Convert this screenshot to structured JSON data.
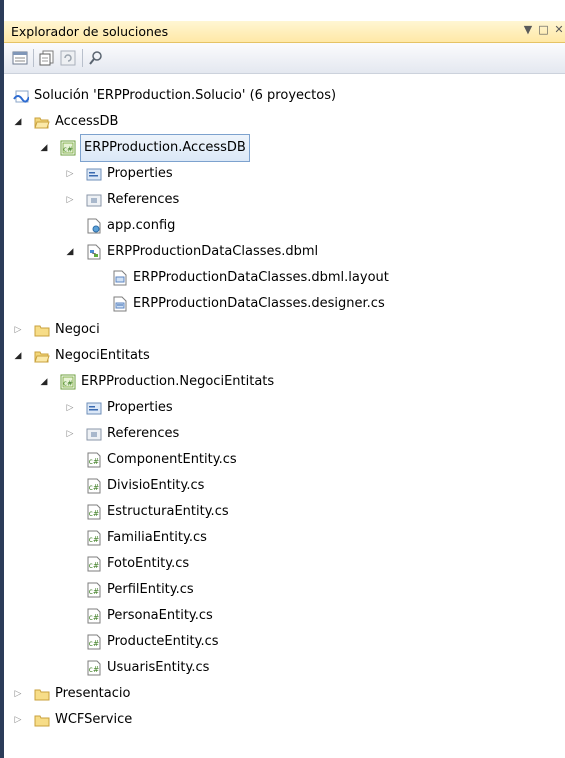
{
  "panel": {
    "title": "Explorador de soluciones",
    "controls": {
      "dropdown": "▼",
      "restore": "□",
      "close": "✕"
    }
  },
  "toolbar": {
    "buttons": [
      "properties-icon",
      "show-all-files-icon",
      "refresh-icon",
      "view-class-diagram-icon"
    ]
  },
  "tree": {
    "items": [
      {
        "label": "Solución 'ERPProduction.Solucio'  (6 proyectos)",
        "icon": "solution-icon",
        "depth": 0,
        "expander": "none"
      },
      {
        "label": "AccessDB",
        "icon": "folder-open-icon",
        "depth": 1,
        "expander": "open"
      },
      {
        "label": "ERPProduction.AccessDB",
        "icon": "csharp-project-icon",
        "depth": 2,
        "expander": "open",
        "selected": true
      },
      {
        "label": "Properties",
        "icon": "properties-folder-icon",
        "depth": 3,
        "expander": "closed"
      },
      {
        "label": "References",
        "icon": "references-icon",
        "depth": 3,
        "expander": "closed"
      },
      {
        "label": "app.config",
        "icon": "config-file-icon",
        "depth": 3,
        "expander": "none"
      },
      {
        "label": "ERPProductionDataClasses.dbml",
        "icon": "dbml-icon",
        "depth": 3,
        "expander": "open"
      },
      {
        "label": "ERPProductionDataClasses.dbml.layout",
        "icon": "layout-file-icon",
        "depth": 4,
        "expander": "none"
      },
      {
        "label": "ERPProductionDataClasses.designer.cs",
        "icon": "cs-designer-icon",
        "depth": 4,
        "expander": "none"
      },
      {
        "label": "Negoci",
        "icon": "folder-closed-icon",
        "depth": 1,
        "expander": "closed"
      },
      {
        "label": "NegociEntitats",
        "icon": "folder-open-icon",
        "depth": 1,
        "expander": "open"
      },
      {
        "label": "ERPProduction.NegociEntitats",
        "icon": "csharp-project-icon",
        "depth": 2,
        "expander": "open"
      },
      {
        "label": "Properties",
        "icon": "properties-folder-icon",
        "depth": 3,
        "expander": "closed"
      },
      {
        "label": "References",
        "icon": "references-icon",
        "depth": 3,
        "expander": "closed"
      },
      {
        "label": "ComponentEntity.cs",
        "icon": "cs-file-icon",
        "depth": 3,
        "expander": "none"
      },
      {
        "label": "DivisioEntity.cs",
        "icon": "cs-file-icon",
        "depth": 3,
        "expander": "none"
      },
      {
        "label": "EstructuraEntity.cs",
        "icon": "cs-file-icon",
        "depth": 3,
        "expander": "none"
      },
      {
        "label": "FamiliaEntity.cs",
        "icon": "cs-file-icon",
        "depth": 3,
        "expander": "none"
      },
      {
        "label": "FotoEntity.cs",
        "icon": "cs-file-icon",
        "depth": 3,
        "expander": "none"
      },
      {
        "label": "PerfilEntity.cs",
        "icon": "cs-file-icon",
        "depth": 3,
        "expander": "none"
      },
      {
        "label": "PersonaEntity.cs",
        "icon": "cs-file-icon",
        "depth": 3,
        "expander": "none"
      },
      {
        "label": "ProducteEntity.cs",
        "icon": "cs-file-icon",
        "depth": 3,
        "expander": "none"
      },
      {
        "label": "UsuarisEntity.cs",
        "icon": "cs-file-icon",
        "depth": 3,
        "expander": "none"
      },
      {
        "label": "Presentacio",
        "icon": "folder-closed-icon",
        "depth": 1,
        "expander": "closed"
      },
      {
        "label": "WCFService",
        "icon": "folder-closed-icon",
        "depth": 1,
        "expander": "closed"
      }
    ]
  },
  "colors": {
    "title_bar": "#ffe8a6",
    "selection_border": "#7da2ce",
    "left_border": "#2b3c59"
  }
}
